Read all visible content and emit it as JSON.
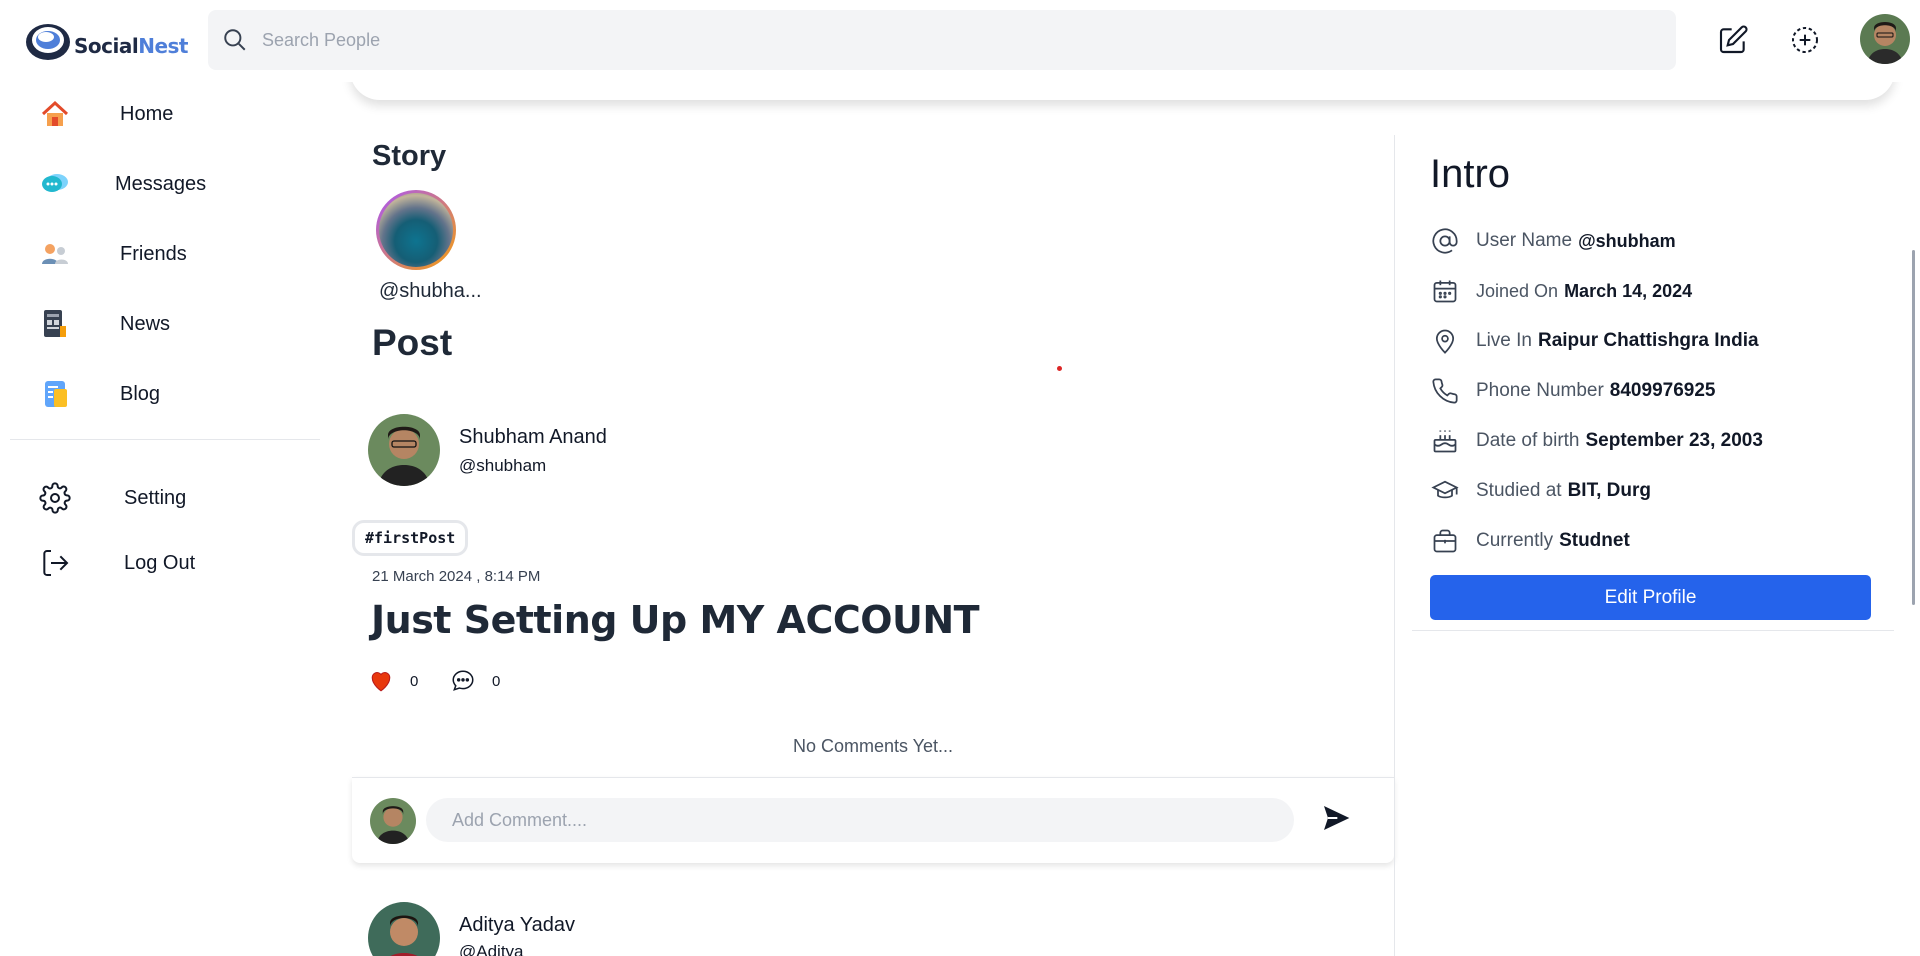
{
  "brand": {
    "name_a": "Social",
    "name_b": "Nest"
  },
  "search": {
    "placeholder": "Search People"
  },
  "sidebar": {
    "items": [
      {
        "label": "Home",
        "icon": "home-icon"
      },
      {
        "label": "Messages",
        "icon": "messages-icon"
      },
      {
        "label": "Friends",
        "icon": "friends-icon"
      },
      {
        "label": "News",
        "icon": "news-icon"
      },
      {
        "label": "Blog",
        "icon": "blog-icon"
      }
    ],
    "bottom": [
      {
        "label": "Setting",
        "icon": "gear-icon"
      },
      {
        "label": "Log Out",
        "icon": "logout-icon"
      }
    ]
  },
  "story": {
    "title": "Story",
    "items": [
      {
        "name": "@shubha..."
      }
    ]
  },
  "posts_section": {
    "title": "Post"
  },
  "post": {
    "author_name": "Shubham Anand",
    "author_handle": "@shubham",
    "hashtag": "#firstPost",
    "date": "21 March 2024 , 8:14 PM",
    "title": "Just Setting Up MY ACCOUNT",
    "likes": "0",
    "comments": "0",
    "no_comments": "No Comments Yet...",
    "comment_placeholder": "Add Comment...."
  },
  "next_post": {
    "author_name": "Aditya Yadav",
    "author_handle": "@Aditya"
  },
  "intro": {
    "title": "Intro",
    "rows": [
      {
        "icon": "at-icon",
        "key": "User Name",
        "value": "@shubham"
      },
      {
        "icon": "calendar-icon",
        "key": "Joined On",
        "value": "March 14, 2024"
      },
      {
        "icon": "location-pin-icon",
        "key": "Live In",
        "value": "Raipur Chattishgra India"
      },
      {
        "icon": "phone-icon",
        "key": "Phone Number",
        "value": "8409976925"
      },
      {
        "icon": "cake-icon",
        "key": "Date of birth",
        "value": "September 23, 2003"
      },
      {
        "icon": "graduation-cap-icon",
        "key": "Studied at",
        "value": "BIT, Durg"
      },
      {
        "icon": "briefcase-icon",
        "key": "Currently",
        "value": "Studnet"
      }
    ],
    "edit_label": "Edit Profile"
  },
  "colors": {
    "accent": "#2563eb",
    "like": "#e8380d",
    "brand_blue": "#4f7fd9"
  }
}
